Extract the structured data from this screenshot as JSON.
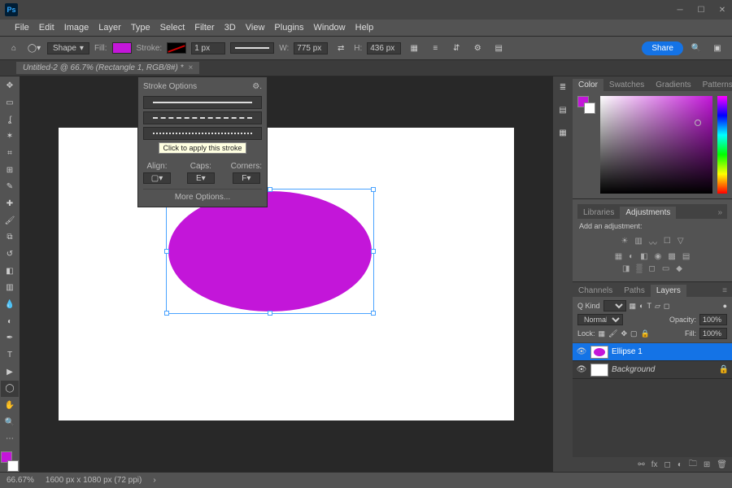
{
  "menus": [
    "File",
    "Edit",
    "Image",
    "Layer",
    "Type",
    "Select",
    "Filter",
    "3D",
    "View",
    "Plugins",
    "Window",
    "Help"
  ],
  "options": {
    "shape_mode": "Shape",
    "fill_label": "Fill:",
    "stroke_label": "Stroke:",
    "stroke_width": "1 px",
    "w_label": "W:",
    "w_value": "775 px",
    "link_icon": "⇄",
    "h_label": "H:",
    "h_value": "436 px",
    "share": "Share"
  },
  "doc_tab": "Untitled-2 @ 66.7% (Rectangle 1, RGB/8#) *",
  "stroke_popup": {
    "title": "Stroke Options",
    "tooltip": "Click to apply this stroke",
    "align": "Align:",
    "caps": "Caps:",
    "corners": "Corners:",
    "more": "More Options..."
  },
  "panel_tabs": {
    "color": "Color",
    "swatches": "Swatches",
    "gradients": "Gradients",
    "patterns": "Patterns",
    "libraries": "Libraries",
    "adjustments": "Adjustments",
    "channels": "Channels",
    "paths": "Paths",
    "layers": "Layers"
  },
  "adjust": {
    "add": "Add an adjustment:"
  },
  "layers_ctrl": {
    "kind_label": "Q Kind",
    "blend": "Normal",
    "opacity_label": "Opacity:",
    "opacity": "100%",
    "lock_label": "Lock:",
    "fill_label": "Fill:",
    "fill": "100%"
  },
  "layers": [
    {
      "name": "Ellipse 1",
      "selected": true,
      "locked": false,
      "hasEllipse": true
    },
    {
      "name": "Background",
      "selected": false,
      "locked": true,
      "italic": true,
      "hasEllipse": false
    }
  ],
  "status": {
    "zoom": "66.67%",
    "doc": "1600 px x 1080 px (72 ppi)"
  }
}
